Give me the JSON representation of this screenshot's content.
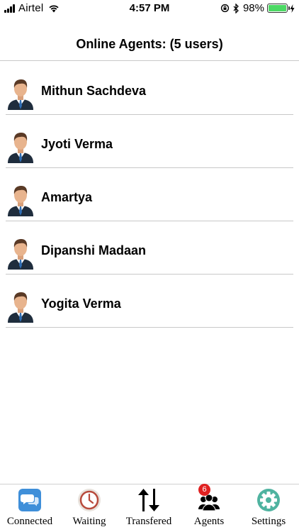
{
  "status_bar": {
    "carrier": "Airtel",
    "time": "4:57 PM",
    "battery_percent": "98%",
    "battery_level": 0.98
  },
  "header": {
    "title": "Online Agents: (5 users)"
  },
  "agents": [
    {
      "name": "Mithun Sachdeva"
    },
    {
      "name": "Jyoti Verma"
    },
    {
      "name": "Amartya"
    },
    {
      "name": "Dipanshi Madaan"
    },
    {
      "name": "Yogita Verma"
    }
  ],
  "tab_bar": {
    "tabs": [
      {
        "label": "Connected",
        "icon": "chat-bubbles-icon"
      },
      {
        "label": "Waiting",
        "icon": "clock-icon"
      },
      {
        "label": "Transfered",
        "icon": "transfer-arrows-icon"
      },
      {
        "label": "Agents",
        "icon": "people-icon",
        "badge": "6"
      },
      {
        "label": "Settings",
        "icon": "gear-icon"
      }
    ]
  },
  "colors": {
    "battery_fill": "#4cd964",
    "connected_icon": "#3f8fd9",
    "settings_icon": "#4fb3a0",
    "badge": "#e02020"
  }
}
